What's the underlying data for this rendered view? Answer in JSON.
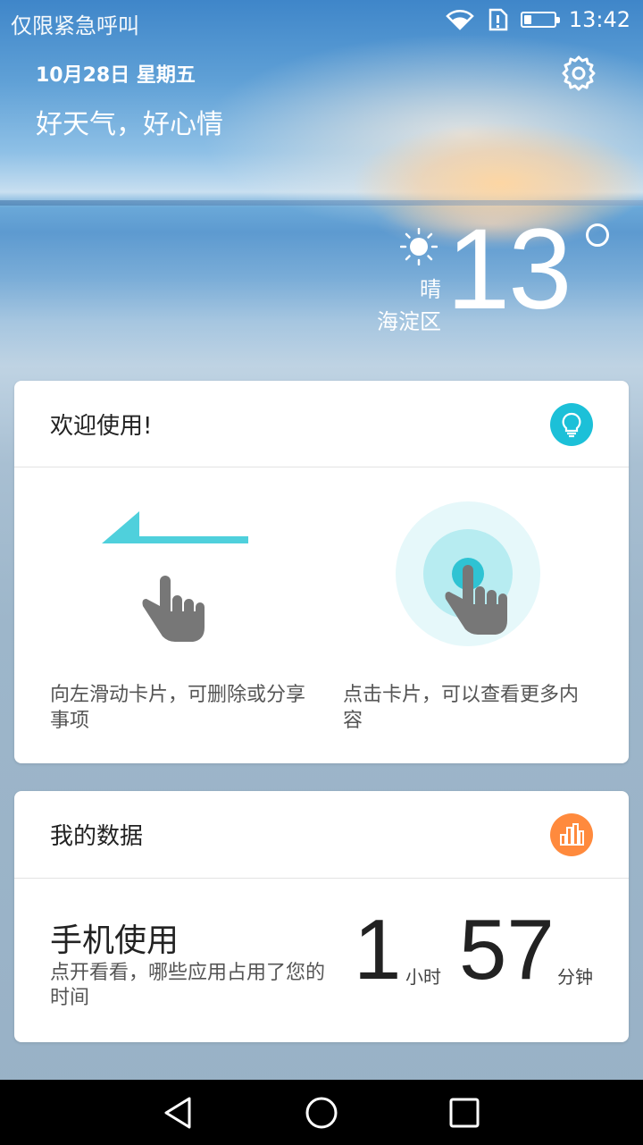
{
  "status_bar": {
    "carrier_text": "仅限紧急呼叫",
    "time": "13:42",
    "battery_level": 0.25
  },
  "header": {
    "date": "10月28日 星期五",
    "slogan": "好天气，好心情"
  },
  "weather": {
    "temperature": "13",
    "condition": "晴",
    "location": "海淀区"
  },
  "welcome_card": {
    "title": "欢迎使用!",
    "swipe_tip": "向左滑动卡片，可删除或分享事项",
    "tap_tip": "点击卡片，可以查看更多内容",
    "accent_color": "#1cc0d8"
  },
  "data_card": {
    "title": "我的数据",
    "metric_title": "手机使用",
    "metric_subtitle": "点开看看，哪些应用占用了您的时间",
    "hours": "1",
    "hours_unit": "小时",
    "minutes": "57",
    "minutes_unit": "分钟",
    "accent_color": "#ff8a3d"
  },
  "icons": {
    "wifi": "wifi-icon",
    "sim": "sim-alert-icon",
    "battery": "battery-icon",
    "settings": "gear-icon",
    "sun": "sun-icon",
    "bulb": "lightbulb-icon",
    "chart": "bar-chart-icon",
    "back": "back-icon",
    "home": "home-icon",
    "recents": "recents-icon"
  }
}
